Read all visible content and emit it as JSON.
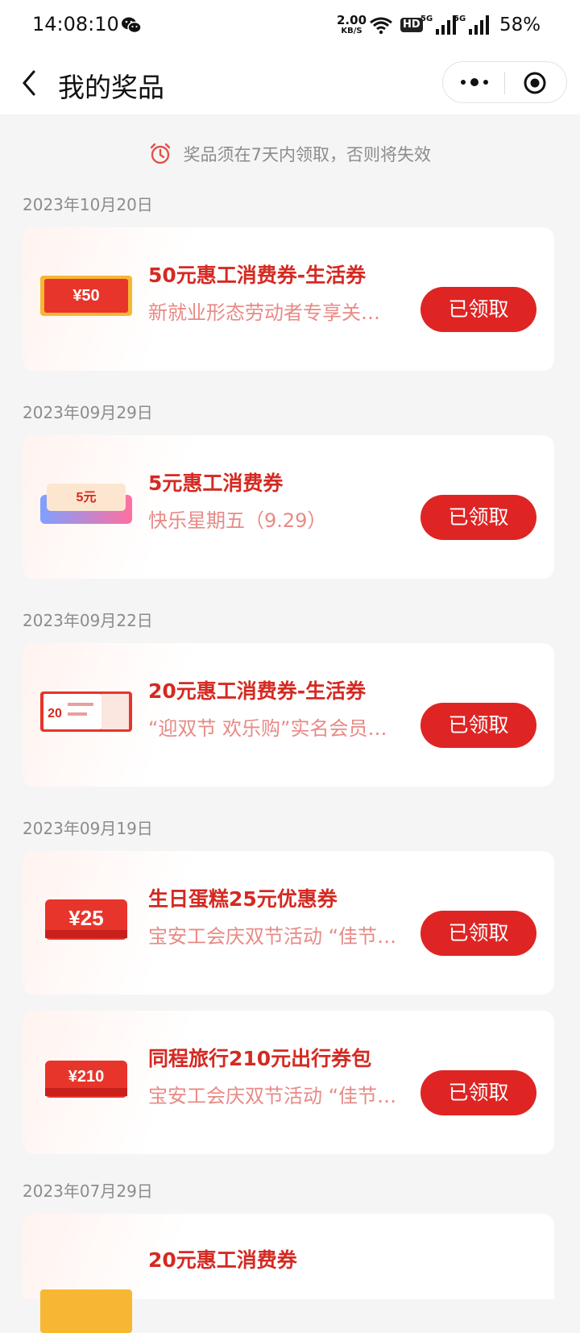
{
  "status_bar": {
    "time": "14:08:10",
    "net_speed_value": "2.00",
    "net_speed_unit": "KB/S",
    "hd_label": "HD",
    "sig1_label": "5G",
    "sig2_label": "5G",
    "battery": "58%"
  },
  "nav": {
    "title": "我的奖品"
  },
  "notice": {
    "text": "奖品须在7天内领取，否则将失效"
  },
  "dates": [
    "2023年10月20日",
    "2023年09月29日",
    "2023年09月22日",
    "2023年09月19日",
    "2023年07月29日"
  ],
  "prizes": [
    {
      "title": "50元惠工消费券-生活券",
      "subtitle": "新就业形态劳动者专享关爱活动",
      "button": "已领取",
      "thumb_text": "¥50"
    },
    {
      "title": "5元惠工消费券",
      "subtitle": "快乐星期五（9.29）",
      "button": "已领取",
      "thumb_text": "5元"
    },
    {
      "title": "20元惠工消费券-生活券",
      "subtitle": "“迎双节 欢乐购”实名会员专享活动",
      "button": "已领取",
      "thumb_text": "20"
    },
    {
      "title": "生日蛋糕25元优惠券",
      "subtitle": "宝安工会庆双节活动 “佳节同庆”",
      "button": "已领取",
      "thumb_text": "¥25"
    },
    {
      "title": "同程旅行210元出行券包",
      "subtitle": "宝安工会庆双节活动 “佳节同庆”",
      "button": "已领取",
      "thumb_text": "¥210"
    },
    {
      "title": "20元惠工消费券",
      "subtitle": "",
      "button": "",
      "thumb_text": ""
    }
  ],
  "colors": {
    "accent": "#de2524",
    "title_red": "#d42a22",
    "subtitle_pink": "#e78a86",
    "bg": "#f5f5f5"
  }
}
